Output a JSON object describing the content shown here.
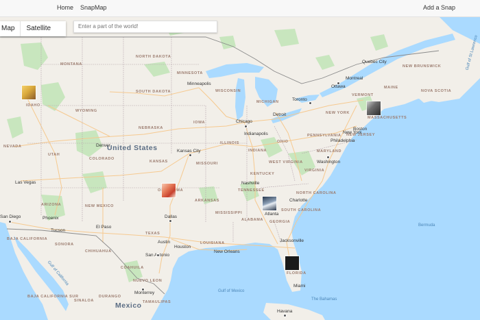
{
  "nav": {
    "home": "Home",
    "snapmap": "SnapMap",
    "add_snap": "Add a Snap"
  },
  "maptype": {
    "map": "Map",
    "satellite": "Satellite"
  },
  "search": {
    "placeholder": "Enter a part of the world!"
  },
  "map_labels": {
    "country_us": "United States",
    "country_mx": "Mexico",
    "montana": "MONTANA",
    "north_dakota": "NORTH DAKOTA",
    "minnesota": "MINNESOTA",
    "south_dakota": "SOUTH DAKOTA",
    "wisconsin": "WISCONSIN",
    "michigan": "MICHIGAN",
    "idaho": "IDAHO",
    "wyoming": "WYOMING",
    "nebraska": "NEBRASKA",
    "iowa": "IOWA",
    "nevada": "NEVADA",
    "utah": "UTAH",
    "colorado": "COLORADO",
    "kansas": "KANSAS",
    "missouri": "MISSOURI",
    "illinois": "ILLINOIS",
    "indiana": "INDIANA",
    "ohio": "OHIO",
    "pennsylvania": "PENNSYLVANIA",
    "new_york": "NEW YORK",
    "vermont": "VERMONT",
    "maine": "MAINE",
    "new_brunswick": "NEW BRUNSWICK",
    "nova_scotia": "NOVA SCOTIA",
    "massachusetts": "MASSACHUSETTS",
    "maryland": "MARYLAND",
    "new_jersey": "NEW JERSEY",
    "west_virginia": "WEST VIRGINIA",
    "virginia": "VIRGINIA",
    "kentucky": "KENTUCKY",
    "tennessee": "TENNESSEE",
    "north_carolina": "NORTH CAROLINA",
    "south_carolina": "SOUTH CAROLINA",
    "arkansas": "ARKANSAS",
    "oklahoma": "OKLAHOMA",
    "new_mexico": "NEW MEXICO",
    "arizona": "ARIZONA",
    "texas": "TEXAS",
    "louisiana": "LOUISIANA",
    "mississippi": "MISSISSIPPI",
    "alabama": "ALABAMA",
    "georgia": "GEORGIA",
    "florida": "FLORIDA",
    "baja_california": "BAJA CALIFORNIA",
    "sonora": "SONORA",
    "chihuahua": "CHIHUAHUA",
    "coahuila": "COAHUILA",
    "nuevo_leon": "NUEVO LEON",
    "durango": "DURANGO",
    "tamaulipas": "TAMAULIPAS",
    "sinaloa": "SINALOA",
    "baja_california_sur": "BAJA CALIFORNIA SUR",
    "quebec_city": "Quebec City",
    "montreal": "Montreal",
    "ottawa": "Ottawa",
    "toronto": "Toronto",
    "boston": "Boston",
    "new_york_city": "New York",
    "philadelphia": "Philadelphia",
    "washington": "Washington",
    "detroit": "Detroit",
    "chicago": "Chicago",
    "minneapolis": "Minneapolis",
    "indianapolis": "Indianapolis",
    "nashville": "Nashville",
    "charlotte": "Charlotte",
    "atlanta": "Atlanta",
    "jacksonville": "Jacksonville",
    "miami": "Miami",
    "new_orleans": "New Orleans",
    "houston": "Houston",
    "austin": "Austin",
    "san_antonio": "San Antonio",
    "dallas": "Dallas",
    "kansas_city": "Kansas City",
    "denver": "Denver",
    "las_vegas": "Las Vegas",
    "san_diego": "San Diego",
    "phoenix": "Phoenix",
    "tucson": "Tucson",
    "el_paso": "El Paso",
    "monterrey": "Monterrey",
    "havana": "Havana",
    "bermuda": "Bermuda",
    "the_bahamas": "The Bahamas",
    "gulf_of_mexico": "Gulf of Mexico",
    "gulf_of_california": "Gulf of California",
    "gulf_st_lawrence": "Gulf of St Lawrence"
  },
  "snaps": [
    {
      "name": "snap-idaho"
    },
    {
      "name": "snap-oklahoma"
    },
    {
      "name": "snap-georgia"
    },
    {
      "name": "snap-florida"
    },
    {
      "name": "snap-massachusetts"
    }
  ],
  "colors": {
    "water": "#aadaff",
    "land": "#f2efe9",
    "park": "#c8e6be",
    "road": "#f6c98f",
    "border": "#9a9a9a"
  }
}
